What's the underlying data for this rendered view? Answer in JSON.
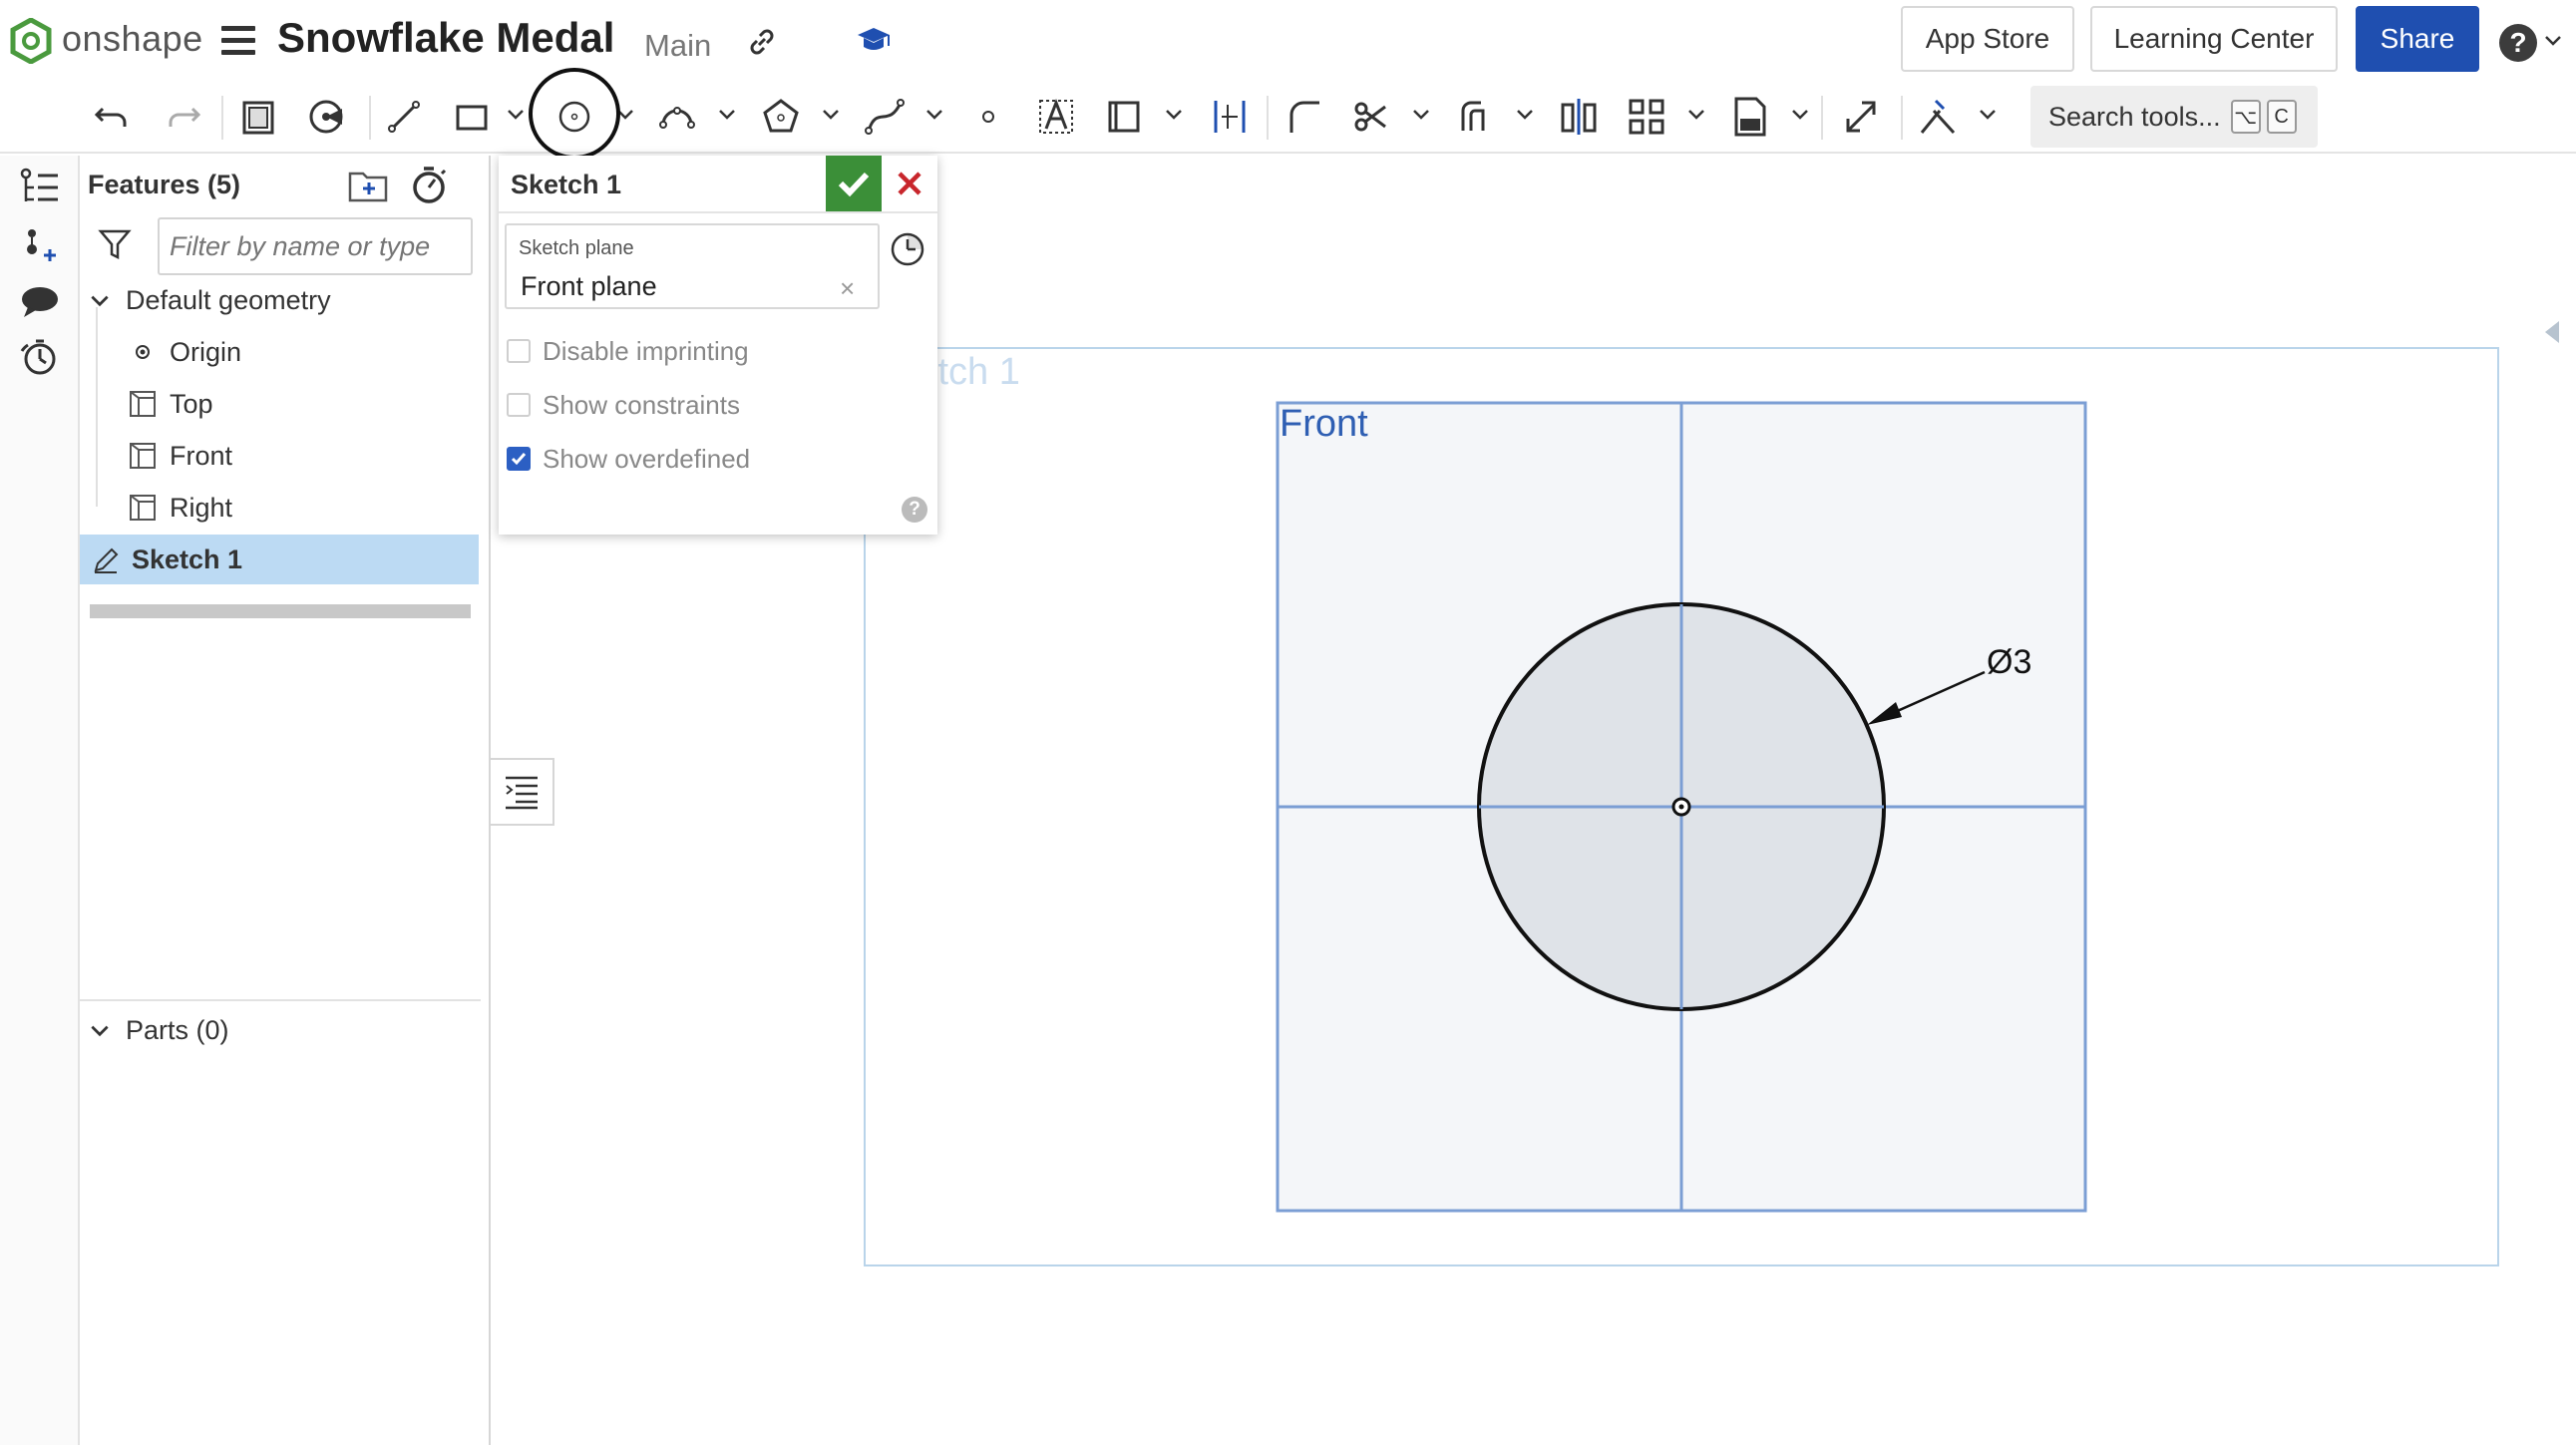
{
  "header": {
    "logo_text": "onshape",
    "doc_title": "Snowflake Medal",
    "branch": "Main",
    "app_store": "App Store",
    "learning_center": "Learning Center",
    "share": "Share",
    "help_glyph": "?"
  },
  "toolbar": {
    "search_label": "Search tools...",
    "shortcut_keys": [
      "⌥",
      "C"
    ],
    "icons": [
      "undo-icon",
      "redo-icon",
      "sketch-icon",
      "view-normal-icon",
      "line-icon",
      "rectangle-icon",
      "circle-icon",
      "arc-icon",
      "polygon-icon",
      "spline-icon",
      "point-icon",
      "text-icon",
      "construction-icon",
      "dimension-icon",
      "fillet-icon",
      "trim-icon",
      "offset-icon",
      "mirror-icon",
      "pattern-icon",
      "dxf-icon",
      "transform-icon",
      "constraint-icon"
    ]
  },
  "features": {
    "title": "Features (5)",
    "filter_placeholder": "Filter by name or type",
    "default_geometry": "Default geometry",
    "items": [
      {
        "label": "Origin",
        "icon": "origin-icon"
      },
      {
        "label": "Top",
        "icon": "plane-icon"
      },
      {
        "label": "Front",
        "icon": "plane-icon"
      },
      {
        "label": "Right",
        "icon": "plane-icon"
      }
    ],
    "sketch": "Sketch 1",
    "parts": "Parts (0)"
  },
  "dialog": {
    "title": "Sketch 1",
    "plane_label": "Sketch plane",
    "plane_value": "Front plane",
    "clear_glyph": "×",
    "options": [
      {
        "label": "Disable imprinting",
        "checked": false
      },
      {
        "label": "Show constraints",
        "checked": false
      },
      {
        "label": "Show overdefined",
        "checked": true
      }
    ],
    "help_glyph": "?"
  },
  "canvas": {
    "sketch_label": "Sketch 1",
    "plane_label": "Front",
    "dimension": "Ø3"
  },
  "colors": {
    "accent": "#1f4fb0",
    "confirm": "#3b8f38",
    "cancel": "#c8262c",
    "selection": "#bcdaf3",
    "plane_line": "#7b9ed4"
  }
}
